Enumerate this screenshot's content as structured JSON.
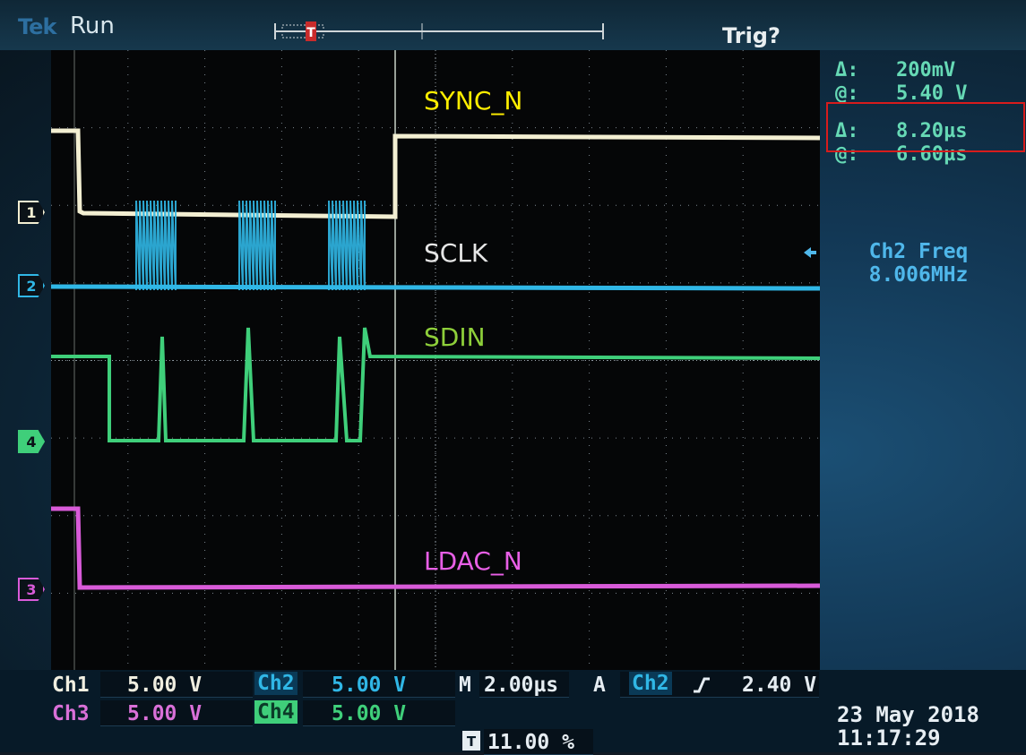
{
  "header": {
    "brand": "Tek",
    "run_state": "Run",
    "trigger_status": "Trig?"
  },
  "signals": {
    "sync": {
      "label": "SYNC_N",
      "color": "#ffee00"
    },
    "sclk": {
      "label": "SCLK",
      "color": "#e6e6e6"
    },
    "sdin": {
      "label": "SDIN",
      "color": "#8ecf3a"
    },
    "ldac": {
      "label": "LDAC_N",
      "color": "#e85fe6"
    }
  },
  "channel_markers": {
    "ch1": "1",
    "ch2": "2",
    "ch3": "3",
    "ch4": "4"
  },
  "trace_colors": {
    "ch1": "#f3efd2",
    "ch2": "#30b7e6",
    "ch3": "#d95bd9",
    "ch4": "#3fcf7a"
  },
  "cursor_readouts": {
    "v_delta_label": "Δ:",
    "v_delta": "200mV",
    "v_at_label": "@:",
    "v_at": "5.40 V",
    "t_delta_label": "Δ:",
    "t_delta": "8.20µs",
    "t_at_label": "@:",
    "t_at": "6.60µs"
  },
  "measurement": {
    "title": "Ch2 Freq",
    "value": "8.006MHz"
  },
  "bottom": {
    "ch1_label": "Ch1",
    "ch1_scale": "5.00 V",
    "ch2_label": "Ch2",
    "ch2_scale": "5.00 V",
    "ch3_label": "Ch3",
    "ch3_scale": "5.00 V",
    "ch4_label": "Ch4",
    "ch4_scale": "5.00 V",
    "timebase_label": "M",
    "timebase": "2.00µs",
    "trig_mode": "A",
    "trig_source": "Ch2",
    "trig_slope_icon": "rising-edge-icon",
    "trig_level": "2.40 V",
    "trig_pos_icon": "trigger-t-icon",
    "trig_position": "11.00 %",
    "date": "23 May 2018",
    "time": "11:17:29"
  }
}
